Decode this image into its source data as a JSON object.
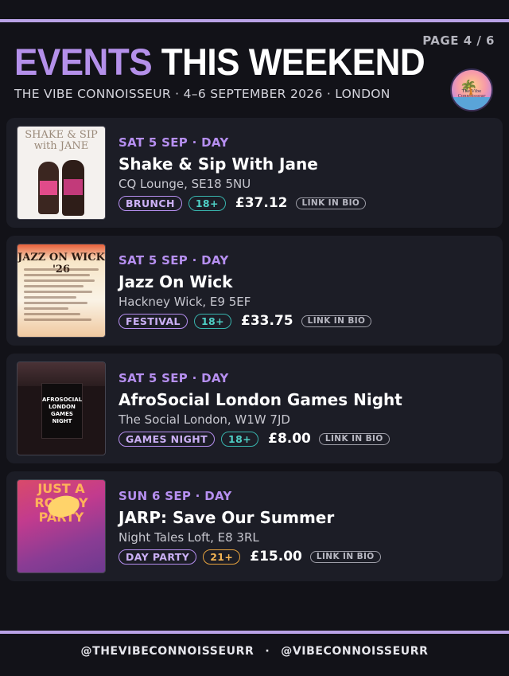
{
  "page": {
    "label": "PAGE 4 / 6"
  },
  "header": {
    "title_accent": "EVENTS",
    "title_main": "THIS WEEKEND",
    "subtitle": "THE VIBE CONNOISSEUR · 4–6 SEPTEMBER 2026 · LONDON",
    "logo_text": "The Vibe Connoisseur"
  },
  "events": [
    {
      "day": "SAT 5 SEP · DAY",
      "name": "Shake & Sip With Jane",
      "venue": "CQ Lounge, SE18 5NU",
      "category": "BRUNCH",
      "age": "18+",
      "price": "£37.12",
      "link": "LINK IN BIO",
      "thumb_text": "SHAKE & SIP with JANE"
    },
    {
      "day": "SAT 5 SEP · DAY",
      "name": "Jazz On Wick",
      "venue": "Hackney Wick, E9 5EF",
      "category": "FESTIVAL",
      "age": "18+",
      "price": "£33.75",
      "link": "LINK IN BIO",
      "thumb_text": "JAZZ ON WICK '26"
    },
    {
      "day": "SAT 5 SEP · DAY",
      "name": "AfroSocial London Games Night",
      "venue": "The Social London, W1W 7JD",
      "category": "GAMES NIGHT",
      "age": "18+",
      "price": "£8.00",
      "link": "LINK IN BIO",
      "thumb_text": "AFROSOCIAL LONDON GAMES NIGHT"
    },
    {
      "day": "SUN 6 SEP · DAY",
      "name": "JARP: Save Our Summer",
      "venue": "Night Tales Loft, E8 3RL",
      "category": "DAY PARTY",
      "age": "21+",
      "price": "£15.00",
      "link": "LINK IN BIO",
      "thumb_text": "JUST A ROWDY PARTY"
    }
  ],
  "footer": {
    "handle_1": "@THEVIBECONNOISSEURR",
    "separator": "·",
    "handle_2": "@VIBECONNOISSEURR"
  },
  "colors": {
    "background": "#121218",
    "card": "#1c1d26",
    "accent_purple": "#b68ff0",
    "accent_teal": "#38b4ad",
    "accent_orange": "#e6a23e"
  }
}
